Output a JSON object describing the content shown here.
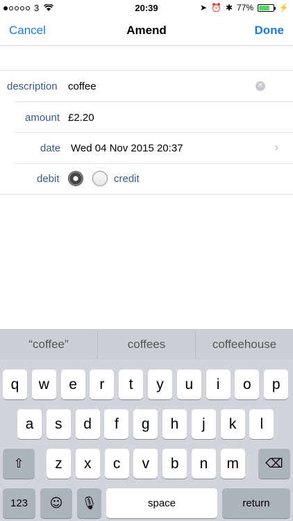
{
  "status": {
    "carrier": "3",
    "time": "20:39",
    "battery_percent": "77%",
    "battery_level": 0.77
  },
  "nav": {
    "cancel": "Cancel",
    "title": "Amend",
    "done": "Done"
  },
  "form": {
    "description_label": "description",
    "description_value": "coffee",
    "amount_label": "amount",
    "amount_value": "£2.20",
    "date_label": "date",
    "date_value": "Wed 04 Nov 2015 20:37",
    "debit_label": "debit",
    "credit_label": "credit",
    "selected_type": "debit"
  },
  "keyboard": {
    "suggestions": [
      "“coffee”",
      "coffees",
      "coffeehouse"
    ],
    "row1": [
      "q",
      "w",
      "e",
      "r",
      "t",
      "y",
      "u",
      "i",
      "o",
      "p"
    ],
    "row2": [
      "a",
      "s",
      "d",
      "f",
      "g",
      "h",
      "j",
      "k",
      "l"
    ],
    "row3": [
      "z",
      "x",
      "c",
      "v",
      "b",
      "n",
      "m"
    ],
    "numbers_label": "123",
    "space_label": "space",
    "return_label": "return"
  }
}
